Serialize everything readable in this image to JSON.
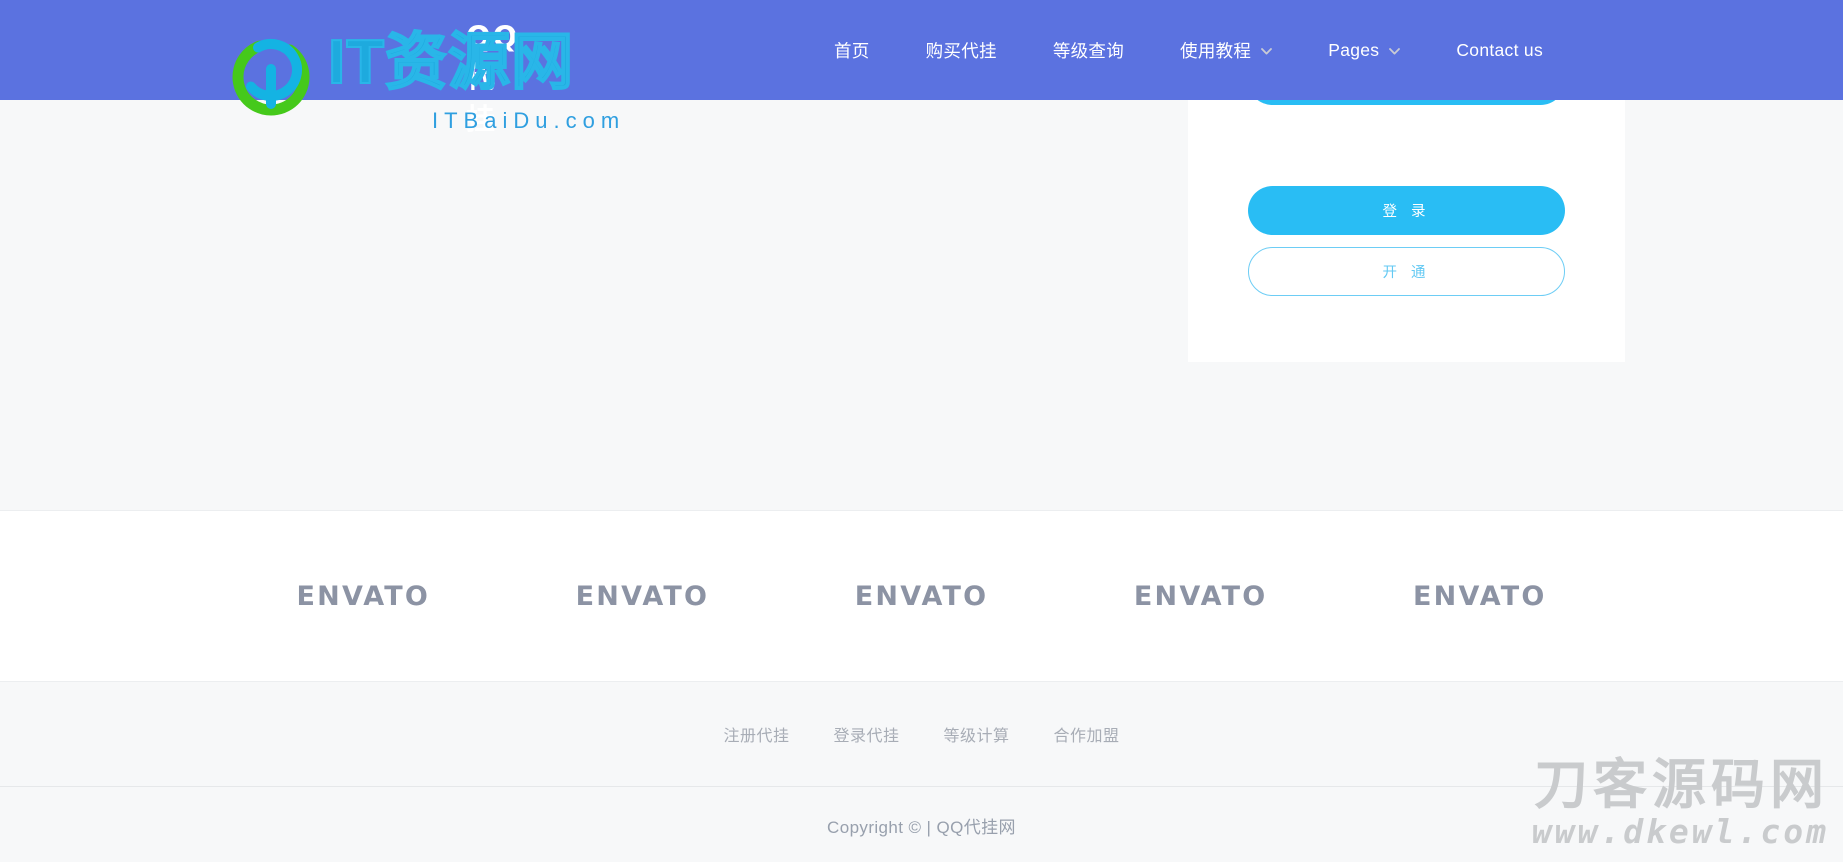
{
  "theme": {
    "header_bg": "#5b72e0",
    "page_bg": "#f7f8f9",
    "accent_blue": "#29bdf4",
    "accent_outline": "#6dcdf5",
    "brand_gray": "#8c93a4",
    "muted_text": "#a8adb6"
  },
  "header": {
    "nav": [
      {
        "label": "首页",
        "has_dropdown": false
      },
      {
        "label": "购买代挂",
        "has_dropdown": false
      },
      {
        "label": "等级查询",
        "has_dropdown": false
      },
      {
        "label": "使用教程",
        "has_dropdown": true
      },
      {
        "label": "Pages",
        "has_dropdown": true
      },
      {
        "label": "Contact us",
        "has_dropdown": false
      }
    ]
  },
  "watermark_logo": {
    "badge_text": "QQ代挂",
    "main_text": "IT资源网",
    "sub_text": "ITBaiDu.com",
    "ring_icon": "circular-ring-icon"
  },
  "login_card": {
    "cut_button_label": "",
    "login_button_label": "登 录",
    "open_button_label": "开 通"
  },
  "brands": {
    "items": [
      {
        "label": "ENVATO"
      },
      {
        "label": "ENVATO"
      },
      {
        "label": "ENVATO"
      },
      {
        "label": "ENVATO"
      },
      {
        "label": "ENVATO"
      }
    ]
  },
  "footer": {
    "links": [
      {
        "label": "注册代挂"
      },
      {
        "label": "登录代挂"
      },
      {
        "label": "等级计算"
      },
      {
        "label": "合作加盟"
      }
    ],
    "copyright": "Copyright © | QQ代挂网"
  },
  "watermark_bottom": {
    "main_text": "刀客源码网",
    "sub_text": "www.dkewl.com"
  }
}
